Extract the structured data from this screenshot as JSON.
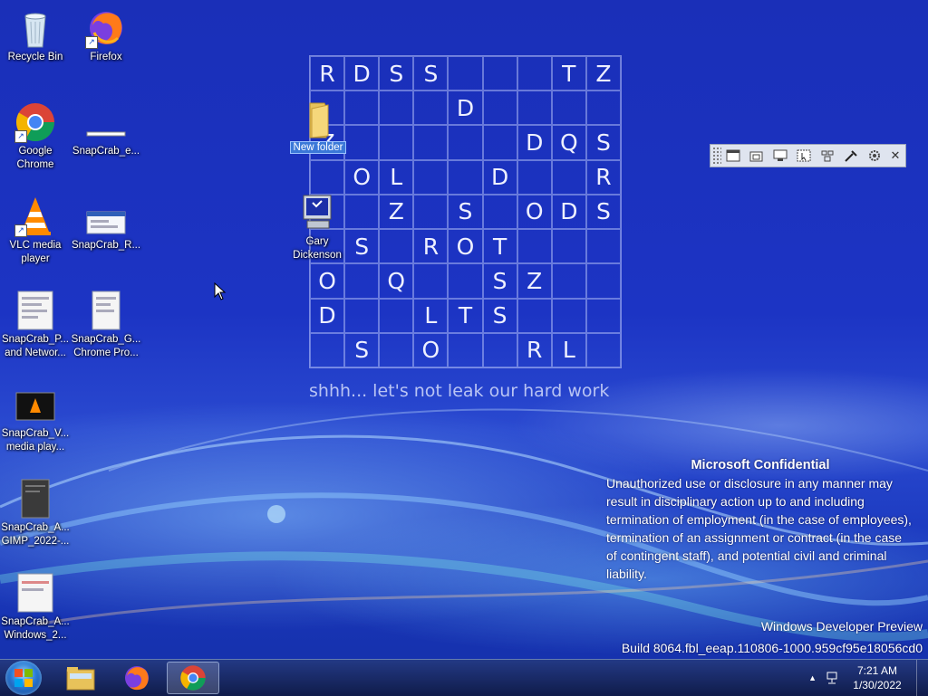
{
  "desktop": {
    "icons": [
      {
        "label": "Recycle Bin",
        "icon": "recycle-bin-icon"
      },
      {
        "label": "Firefox",
        "icon": "firefox-icon"
      },
      {
        "label": "Google Chrome",
        "icon": "chrome-icon"
      },
      {
        "label": "SnapCrab_e...",
        "icon": "screenshot-file-icon"
      },
      {
        "label": "VLC media player",
        "icon": "vlc-icon"
      },
      {
        "label": "SnapCrab_R...",
        "icon": "screenshot-file-icon"
      },
      {
        "label": "SnapCrab_P... and Networ...",
        "icon": "screenshot-file-icon"
      },
      {
        "label": "SnapCrab_G... Chrome Pro...",
        "icon": "screenshot-file-icon"
      },
      {
        "label": "SnapCrab_V... media play...",
        "icon": "screenshot-file-icon"
      },
      {
        "label": "SnapCrab_A... GIMP_2022-...",
        "icon": "screenshot-file-icon"
      },
      {
        "label": "SnapCrab_A... Windows_2...",
        "icon": "screenshot-file-icon"
      },
      {
        "label": "New folder",
        "icon": "folder-icon"
      },
      {
        "label": "Gary Dickenson",
        "icon": "computer-icon"
      }
    ]
  },
  "puzzle": {
    "rows": [
      [
        "R",
        "D",
        "S",
        "S",
        "",
        "",
        "",
        "T",
        "Z"
      ],
      [
        "",
        "",
        "",
        "",
        "D",
        "",
        "",
        "",
        ""
      ],
      [
        "Z",
        "",
        "",
        "",
        "",
        "",
        "D",
        "Q",
        "S"
      ],
      [
        "",
        "O",
        "L",
        "",
        "",
        "D",
        "",
        "",
        "R"
      ],
      [
        "",
        "",
        "Z",
        "",
        "S",
        "",
        "O",
        "D",
        "S"
      ],
      [
        "",
        "S",
        "",
        "R",
        "O",
        "T",
        "",
        "",
        ""
      ],
      [
        "O",
        "",
        "Q",
        "",
        "",
        "S",
        "Z",
        "",
        ""
      ],
      [
        "D",
        "",
        "",
        "L",
        "T",
        "S",
        "",
        "",
        ""
      ],
      [
        "",
        "S",
        "",
        "O",
        "",
        "",
        "R",
        "L",
        ""
      ]
    ],
    "caption": "shhh... let's not leak our hard work"
  },
  "toolbar": {
    "buttons": [
      "window-capture-icon",
      "restore-capture-icon",
      "active-window-icon",
      "screen-capture-icon",
      "pointer-capture-icon",
      "region-capture-icon",
      "eyedropper-icon",
      "settings-gear-icon"
    ],
    "close_label": "✕"
  },
  "watermark": {
    "title": "Microsoft Confidential",
    "body": "Unauthorized use or disclosure in any manner may result in disciplinary action up to and including termination of employment (in the case of employees), termination of an assignment or contract (in the case of contingent staff), and potential civil and criminal liability.",
    "os_name": "Windows Developer Preview",
    "build": "Build 8064.fbl_eeap.110806-1000.959cf95e18056cd0"
  },
  "taskbar": {
    "items": [
      "file-explorer-icon",
      "firefox-icon",
      "chrome-icon"
    ],
    "active_item": "chrome-icon",
    "time": "7:21 AM",
    "date": "1/30/2022",
    "tray_arrow": "▲"
  }
}
